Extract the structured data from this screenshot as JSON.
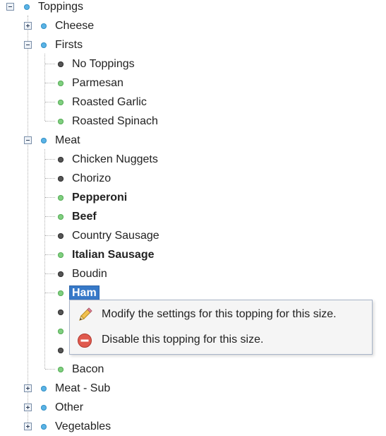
{
  "tree": {
    "root": {
      "label": "Toppings",
      "dot": "blue",
      "toggle": "minus"
    },
    "groups": [
      {
        "label": "Cheese",
        "dot": "blue",
        "toggle": "plus",
        "children": []
      },
      {
        "label": "Firsts",
        "dot": "blue",
        "toggle": "minus",
        "children": [
          {
            "label": "No Toppings",
            "dot": "gray",
            "bold": false
          },
          {
            "label": "Parmesan",
            "dot": "green",
            "bold": false
          },
          {
            "label": "Roasted Garlic",
            "dot": "green",
            "bold": false
          },
          {
            "label": "Roasted Spinach",
            "dot": "green",
            "bold": false
          }
        ]
      },
      {
        "label": "Meat",
        "dot": "blue",
        "toggle": "minus",
        "children": [
          {
            "label": "Chicken Nuggets",
            "dot": "gray",
            "bold": false
          },
          {
            "label": "Chorizo",
            "dot": "gray",
            "bold": false
          },
          {
            "label": "Pepperoni",
            "dot": "green",
            "bold": true
          },
          {
            "label": "Beef",
            "dot": "green",
            "bold": true
          },
          {
            "label": "Country Sausage",
            "dot": "gray",
            "bold": false
          },
          {
            "label": "Italian Sausage",
            "dot": "green",
            "bold": true
          },
          {
            "label": "Boudin",
            "dot": "gray",
            "bold": false
          },
          {
            "label": "Ham",
            "dot": "green",
            "bold": true,
            "selected": true
          },
          {
            "label": "",
            "dot": "gray",
            "bold": false
          },
          {
            "label": "",
            "dot": "green",
            "bold": false
          },
          {
            "label": "",
            "dot": "gray",
            "bold": false
          },
          {
            "label": "Bacon",
            "dot": "green",
            "bold": false
          }
        ]
      },
      {
        "label": "Meat - Sub",
        "dot": "blue",
        "toggle": "plus",
        "children": []
      },
      {
        "label": "Other",
        "dot": "blue",
        "toggle": "plus",
        "children": []
      },
      {
        "label": "Vegetables",
        "dot": "blue",
        "toggle": "plus",
        "children": []
      }
    ]
  },
  "context_menu": {
    "items": [
      {
        "label": "Modify the settings for this topping for this size.",
        "icon": "pencil-icon"
      },
      {
        "label": "Disable this topping for this size.",
        "icon": "disable-icon"
      }
    ]
  },
  "colors": {
    "selection": "#3779c8",
    "group_dot": "#5ab3e6",
    "enabled_dot": "#7fcf7f",
    "disabled_dot": "#555555"
  }
}
